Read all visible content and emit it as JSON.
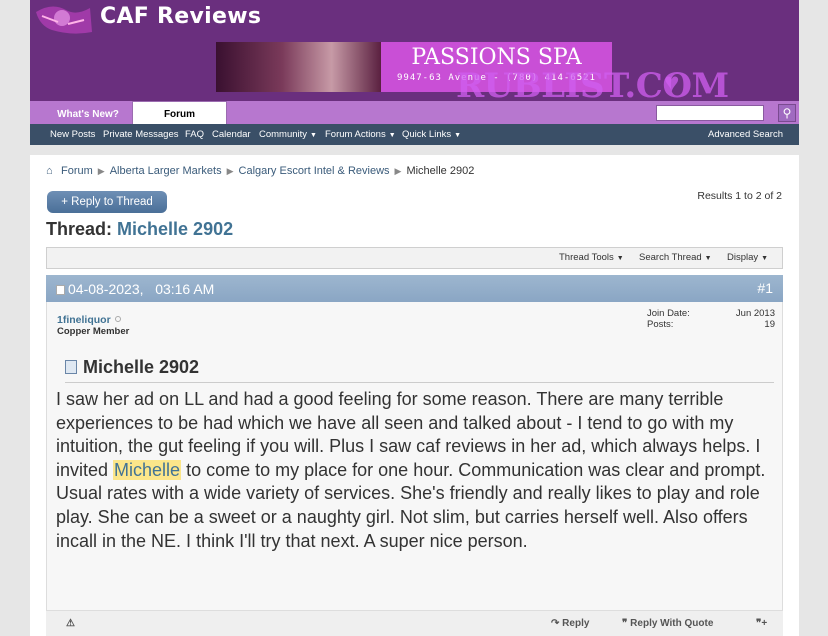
{
  "site": {
    "logo_text": "CAF Reviews"
  },
  "banner": {
    "title": "PASSIONS SPA",
    "subtitle": "9947-63 Avenue - (780) 414-6521"
  },
  "watermark": {
    "text": "RUBLIST.COM"
  },
  "tabs": {
    "whats_new": "What's New?",
    "forum": "Forum"
  },
  "search": {
    "button_icon": "search-icon"
  },
  "nav": {
    "new_posts": "New Posts",
    "private_messages": "Private Messages",
    "faq": "FAQ",
    "calendar": "Calendar",
    "community": "Community",
    "forum_actions": "Forum Actions",
    "quick_links": "Quick Links",
    "advanced_search": "Advanced Search"
  },
  "breadcrumb": {
    "items": [
      "Forum",
      "Alberta Larger Markets",
      "Calgary Escort Intel & Reviews"
    ],
    "current": "Michelle 2902"
  },
  "reply_button": "+ Reply to Thread",
  "results": "Results 1 to 2 of 2",
  "thread": {
    "prefix": "Thread:",
    "title": "Michelle 2902"
  },
  "tools": {
    "thread_tools": "Thread Tools",
    "search_thread": "Search Thread",
    "display": "Display"
  },
  "post": {
    "date": "04-08-2023,",
    "time": "03:16 AM",
    "number": "#1",
    "username": "1fineliquor",
    "usertitle": "Copper Member",
    "join_label": "Join Date:",
    "join_value": "Jun 2013",
    "posts_label": "Posts:",
    "posts_value": "19",
    "title": "Michelle 2902",
    "text_before": "I saw her ad on LL and had a good feeling for some reason. There are many terrible experiences to be had which we have all seen and talked about - I tend to go with my intuition, the gut feeling if you will. Plus I saw caf reviews in her ad, which always helps. I invited ",
    "highlight": "Michelle",
    "text_after": " to come to my place for one hour. Communication was clear and prompt. Usual rates with a wide variety of services. She's friendly and really likes to play and role play. She can be a sweet or a naughty girl. Not slim, but carries herself well. Also offers incall in the NE. I think I'll try that next. A super nice person."
  },
  "post_footer": {
    "reply": "Reply",
    "reply_quote": "Reply With Quote"
  },
  "colors": {
    "header": "#6a2f7e",
    "tabbar": "#b777cf",
    "navbar": "#3a4f67",
    "link": "#417394"
  }
}
